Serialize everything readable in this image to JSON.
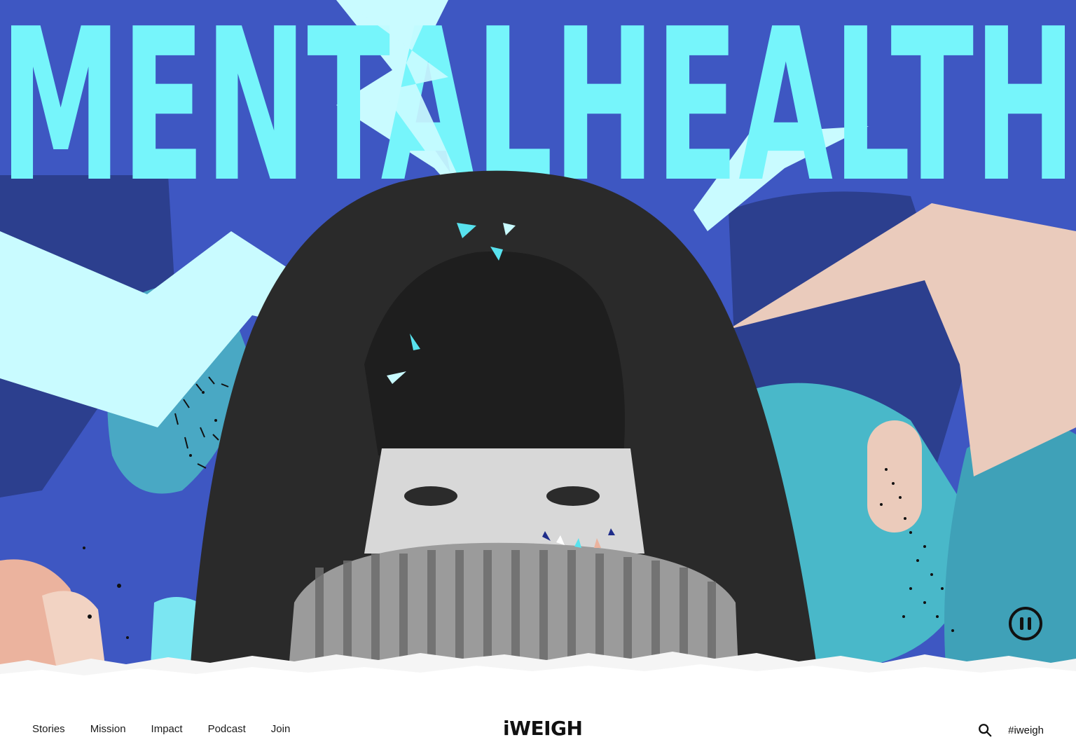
{
  "hero": {
    "headline": "MENTALHEALTH",
    "colors": {
      "background": "#3E57C2",
      "headline": "#76F5FB",
      "lightning": "#C9FBFF",
      "peach": "#EACBBC",
      "teal": "#42A6C2",
      "dark_blue": "#2C3F8E"
    }
  },
  "controls": {
    "pause_icon": "pause-icon"
  },
  "nav": {
    "links": [
      "Stories",
      "Mission",
      "Impact",
      "Podcast",
      "Join"
    ],
    "logo": "iWEIGH",
    "search_icon": "search-icon",
    "hashtag": "#iweigh"
  }
}
